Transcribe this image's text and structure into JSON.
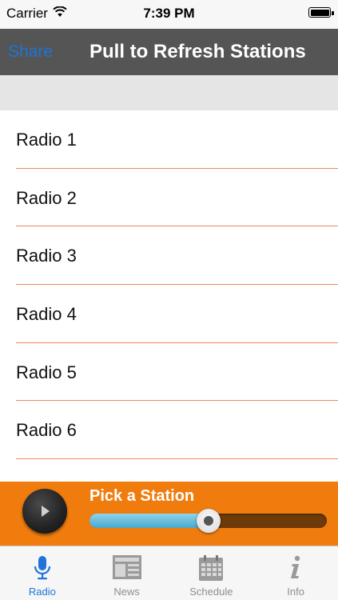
{
  "status_bar": {
    "carrier": "Carrier",
    "time": "7:39 PM"
  },
  "nav_bar": {
    "share_label": "Share",
    "title": "Pull to Refresh Stations"
  },
  "stations": [
    {
      "label": "Radio 1"
    },
    {
      "label": "Radio 2"
    },
    {
      "label": "Radio 3"
    },
    {
      "label": "Radio 4"
    },
    {
      "label": "Radio 5"
    },
    {
      "label": "Radio 6"
    }
  ],
  "player": {
    "title": "Pick a Station",
    "volume_fraction": 0.5
  },
  "tabs": [
    {
      "label": "Radio",
      "icon": "microphone-icon",
      "active": true
    },
    {
      "label": "News",
      "icon": "newspaper-icon",
      "active": false
    },
    {
      "label": "Schedule",
      "icon": "calendar-icon",
      "active": false
    },
    {
      "label": "Info",
      "icon": "info-icon",
      "active": false
    }
  ],
  "colors": {
    "accent": "#1e74d9",
    "nav_background": "#555555",
    "player_background": "#f07c0e",
    "separator": "#f0865a"
  }
}
